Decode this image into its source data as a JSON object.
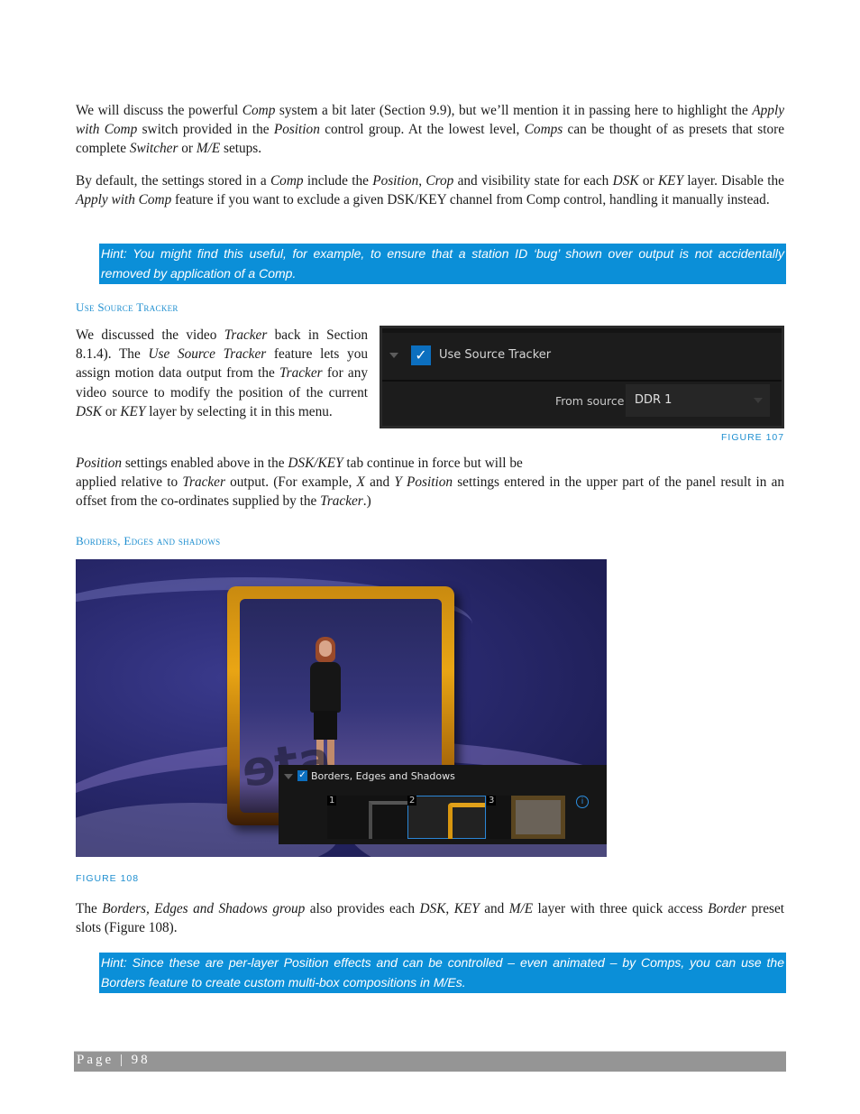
{
  "paragraphs": {
    "p1": [
      {
        "t": "We will discuss the powerful "
      },
      {
        "t": "Comp",
        "i": true
      },
      {
        "t": " system a bit later (Section 9.9), but we’ll mention it in passing here to highlight the "
      },
      {
        "t": "Apply with Comp",
        "i": true
      },
      {
        "t": " switch provided in the "
      },
      {
        "t": "Position",
        "i": true
      },
      {
        "t": " control group.  At the lowest level, "
      },
      {
        "t": "Comps",
        "i": true
      },
      {
        "t": " can be thought of as presets that store complete "
      },
      {
        "t": "Switcher",
        "i": true
      },
      {
        "t": " or "
      },
      {
        "t": "M/E",
        "i": true
      },
      {
        "t": " setups."
      }
    ],
    "p2": [
      {
        "t": "By default, the settings stored in a "
      },
      {
        "t": "Comp",
        "i": true
      },
      {
        "t": " include the "
      },
      {
        "t": "Position",
        "i": true
      },
      {
        "t": ", "
      },
      {
        "t": "Crop",
        "i": true
      },
      {
        "t": " and visibility state for each "
      },
      {
        "t": "DSK",
        "i": true
      },
      {
        "t": " or "
      },
      {
        "t": "KEY",
        "i": true
      },
      {
        "t": " layer.  Disable the "
      },
      {
        "t": "Apply with Comp",
        "i": true
      },
      {
        "t": " feature if you want to exclude a given DSK/KEY channel from Comp control, handling it manually instead."
      }
    ],
    "p3": [
      {
        "t": "We discussed the video "
      },
      {
        "t": "Tracker",
        "i": true
      },
      {
        "t": " back in Section 8.1.4).  The "
      },
      {
        "t": "Use Source Tracker",
        "i": true
      },
      {
        "t": " feature lets you assign motion data output from the "
      },
      {
        "t": "Tracker",
        "i": true
      },
      {
        "t": " for any video source to modify the position of the current "
      },
      {
        "t": "DSK",
        "i": true
      },
      {
        "t": " or "
      },
      {
        "t": "KEY",
        "i": true
      },
      {
        "t": " layer by selecting it in this menu."
      }
    ],
    "p4a": [
      {
        "t": "Position",
        "i": true
      },
      {
        "t": " settings enabled above in the "
      },
      {
        "t": "DSK/KEY",
        "i": true
      },
      {
        "t": " tab continue in force but will be"
      }
    ],
    "p4b": [
      {
        "t": "applied relative to "
      },
      {
        "t": "Tracker",
        "i": true
      },
      {
        "t": " output.  (For example, "
      },
      {
        "t": "X",
        "i": true
      },
      {
        "t": " and "
      },
      {
        "t": "Y Position",
        "i": true
      },
      {
        "t": " settings entered in the upper part of the panel result in an offset from the co-ordinates supplied by the "
      },
      {
        "t": "Tracker",
        "i": true
      },
      {
        "t": ".)"
      }
    ],
    "p5": [
      {
        "t": "The "
      },
      {
        "t": "Borders, Edges and Shadows group",
        "i": true
      },
      {
        "t": " also provides each "
      },
      {
        "t": "DSK",
        "i": true
      },
      {
        "t": ", "
      },
      {
        "t": "KEY",
        "i": true
      },
      {
        "t": " and "
      },
      {
        "t": "M/E",
        "i": true
      },
      {
        "t": " layer with three quick access "
      },
      {
        "t": "Border",
        "i": true
      },
      {
        "t": " preset slots (Figure 108)."
      }
    ]
  },
  "hints": {
    "hint1": "Hint: You might find this useful, for example, to ensure that a station ID ‘bug’ shown over output is not accidentally removed by application of a Comp.",
    "hint2": "Hint: Since these are per-layer Position effects and can be controlled – even animated – by Comps, you can use the Borders feature to create custom multi-box compositions in M/Es."
  },
  "headings": {
    "use_source_tracker": "Use Source Tracker",
    "borders": "Borders, Edges and shadows"
  },
  "figure107": {
    "caption": "FIGURE 107",
    "checkbox_label": "Use Source Tracker",
    "checked": true,
    "from_source_label": "From source",
    "from_source_value": "DDR 1"
  },
  "figure108": {
    "caption": "FIGURE 108",
    "panel_title": "Borders, Edges and Shadows",
    "checked": true,
    "slots": [
      {
        "num": "1",
        "selected": false
      },
      {
        "num": "2",
        "selected": true
      },
      {
        "num": "3",
        "selected": false
      }
    ],
    "info_glyph": "i"
  },
  "footer": {
    "page_label": "Page | 98"
  },
  "colors": {
    "accent": "#0b8fd8",
    "heading": "#1f8fd0",
    "footer_bar": "#959595"
  }
}
